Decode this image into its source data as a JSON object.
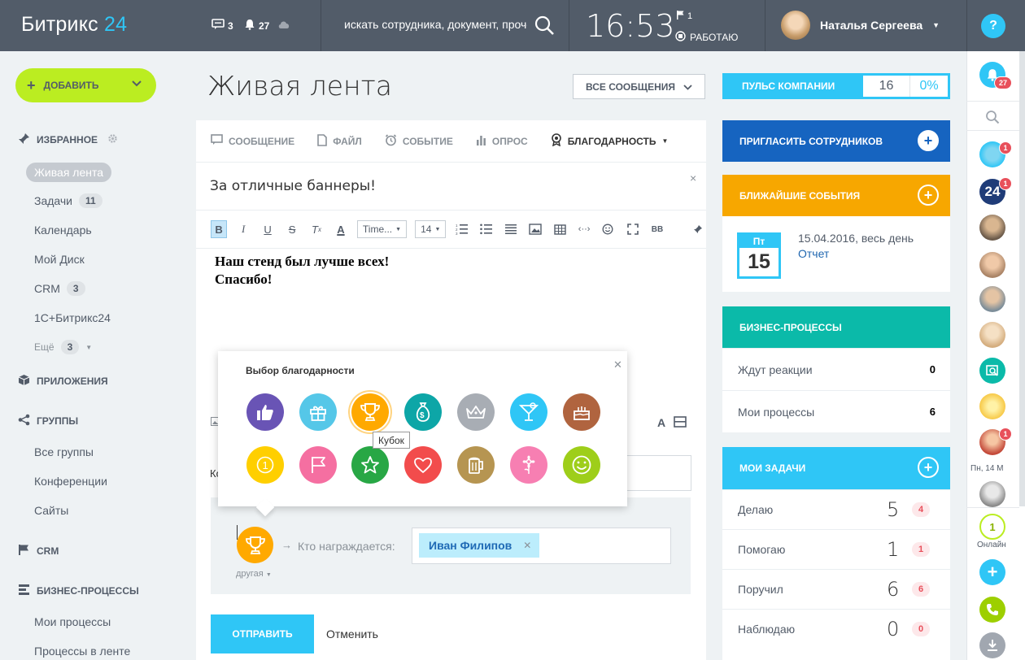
{
  "topbar": {
    "logo_main": "Битрикс",
    "logo_num": "24",
    "messages_count": "3",
    "notifications_count": "27",
    "search_placeholder": "искать сотрудника, документ, прочее",
    "time": "16:53",
    "flag_count": "1",
    "status": "РАБОТАЮ",
    "user_name": "Наталья Сергеева",
    "help": "?"
  },
  "left_menu": {
    "add_label": "ДОБАВИТЬ",
    "favorites": "ИЗБРАННОЕ",
    "items": [
      {
        "label": "Живая лента"
      },
      {
        "label": "Задачи",
        "badge": "11"
      },
      {
        "label": "Календарь"
      },
      {
        "label": "Мой Диск"
      },
      {
        "label": "CRM",
        "badge": "3"
      },
      {
        "label": "1С+Битрикс24"
      },
      {
        "label": "Ещё",
        "badge": "3"
      }
    ],
    "apps": "ПРИЛОЖЕНИЯ",
    "groups": "ГРУППЫ",
    "group_items": [
      "Все группы",
      "Конференции",
      "Сайты"
    ],
    "crm": "CRM",
    "bp": "БИЗНЕС-ПРОЦЕССЫ",
    "bp_items": [
      "Мои процессы",
      "Процессы в ленте"
    ]
  },
  "main": {
    "title": "Живая лента",
    "filter_label": "ВСЕ СООБЩЕНИЯ",
    "tabs": [
      "СООБЩЕНИЕ",
      "ФАЙЛ",
      "СОБЫТИЕ",
      "ОПРОС",
      "БЛАГОДАРНОСТЬ"
    ],
    "subject": "За отличные баннеры!",
    "font_name": "Time...",
    "font_size": "14",
    "body_line1": "Наш стенд был лучше всех!",
    "body_line2": "Спасибо!",
    "to_label": "Ко",
    "grat_other": "другая",
    "grat_who": "Кто награждается:",
    "recipient": "Иван Филипов",
    "send": "ОТПРАВИТЬ",
    "cancel": "Отменить"
  },
  "popup": {
    "title": "Выбор благодарности",
    "tooltip": "Кубок",
    "icons": [
      {
        "name": "like",
        "color": "#6954b5"
      },
      {
        "name": "gift",
        "color": "#55c7e8"
      },
      {
        "name": "cup",
        "color": "#ffa900"
      },
      {
        "name": "money",
        "color": "#0da6a7"
      },
      {
        "name": "crown",
        "color": "#a8adb4"
      },
      {
        "name": "drink",
        "color": "#2fc6f6"
      },
      {
        "name": "cake",
        "color": "#b0643f"
      },
      {
        "name": "number-one",
        "color": "#ffcf00"
      },
      {
        "name": "flag",
        "color": "#f56fa1"
      },
      {
        "name": "star",
        "color": "#28a745"
      },
      {
        "name": "heart",
        "color": "#f24c4c"
      },
      {
        "name": "beer",
        "color": "#b69551"
      },
      {
        "name": "flower",
        "color": "#f77fb2"
      },
      {
        "name": "smile",
        "color": "#9ece1a"
      }
    ]
  },
  "right": {
    "pulse_label": "ПУЛЬС КОМПАНИИ",
    "pulse_num": "16",
    "pulse_pct": "0%",
    "invite": "ПРИГЛАСИТЬ СОТРУДНИКОВ",
    "events": "БЛИЖАЙШИЕ СОБЫТИЯ",
    "event_weekday": "Пт",
    "event_day": "15",
    "event_date": "15.04.2016, весь день",
    "event_title": "Отчет",
    "bp_title": "БИЗНЕС-ПРОЦЕССЫ",
    "bp_rows": [
      {
        "label": "Ждут реакции",
        "value": "0"
      },
      {
        "label": "Мои процессы",
        "value": "6"
      }
    ],
    "tasks_title": "МОИ ЗАДАЧИ",
    "task_rows": [
      {
        "label": "Делаю",
        "value": "5",
        "badge": "4"
      },
      {
        "label": "Помогаю",
        "value": "1",
        "badge": "1"
      },
      {
        "label": "Поручил",
        "value": "6",
        "badge": "6"
      },
      {
        "label": "Наблюдаю",
        "value": "0",
        "badge": "0"
      }
    ]
  },
  "right_sidebar": {
    "notif_count": "27",
    "chat_badges": [
      "1",
      "1"
    ],
    "b24_label": "24",
    "date_label": "Пн, 14 М",
    "online_count": "1",
    "online_label": "Онлайн"
  }
}
